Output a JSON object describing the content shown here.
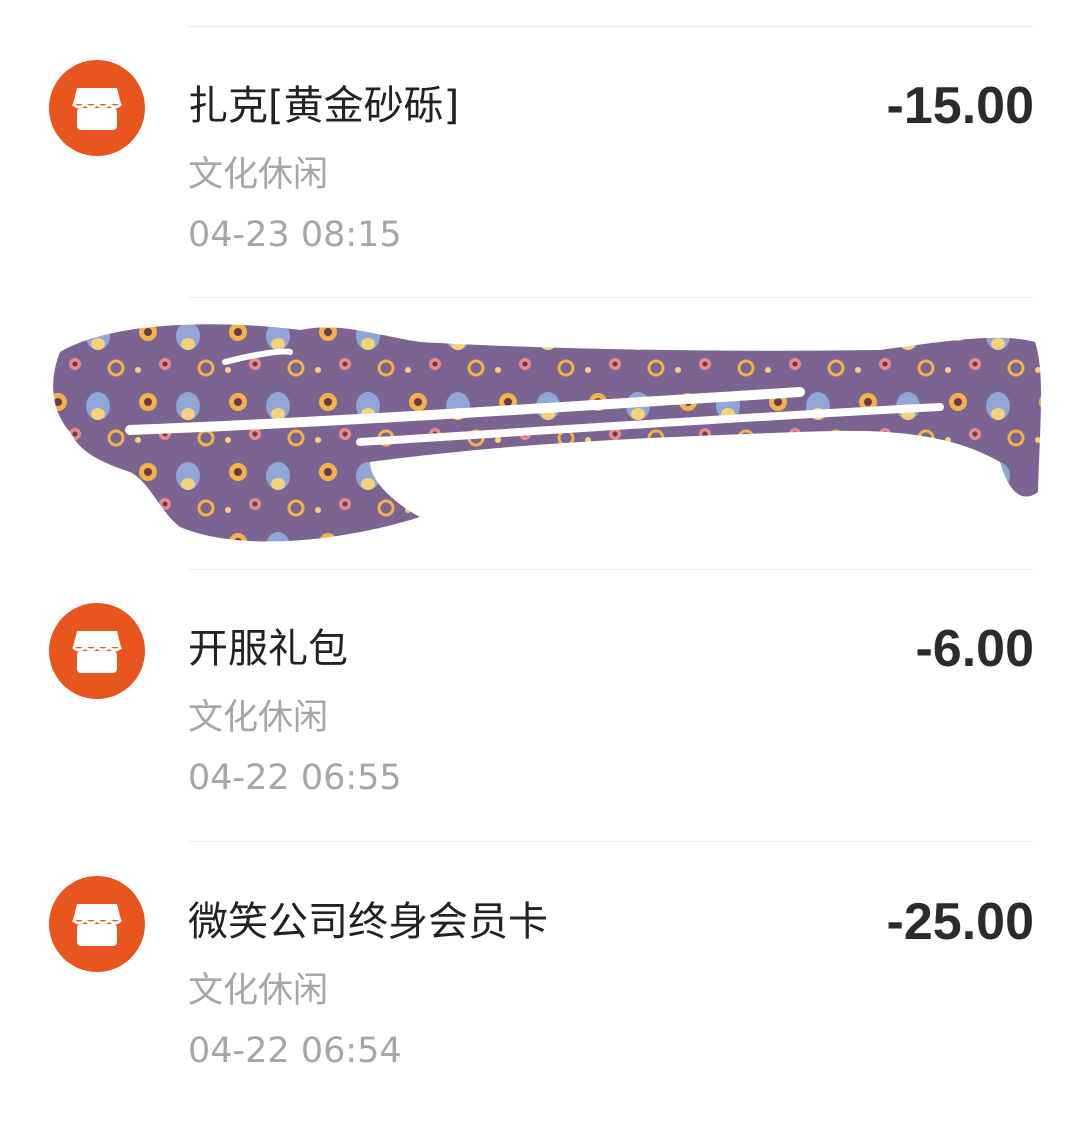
{
  "transactions": [
    {
      "icon": "store-icon",
      "title": "扎克[黄金砂砾]",
      "category": "文化休闲",
      "time": "04-23  08:15",
      "amount": "-15.00"
    },
    {
      "icon": "store-icon",
      "title": "开服礼包",
      "category": "文化休闲",
      "time": "04-22  06:55",
      "amount": "-6.00"
    },
    {
      "icon": "store-icon",
      "title": "微笑公司终身会员卡",
      "category": "文化休闲",
      "time": "04-22  06:54",
      "amount": "-25.00"
    }
  ],
  "colors": {
    "icon_background": "#e9551f",
    "title_text": "#222222",
    "secondary_text": "#a6a6a6",
    "amount_text": "#2b2b2b",
    "redaction_fill": "#7b6491"
  }
}
